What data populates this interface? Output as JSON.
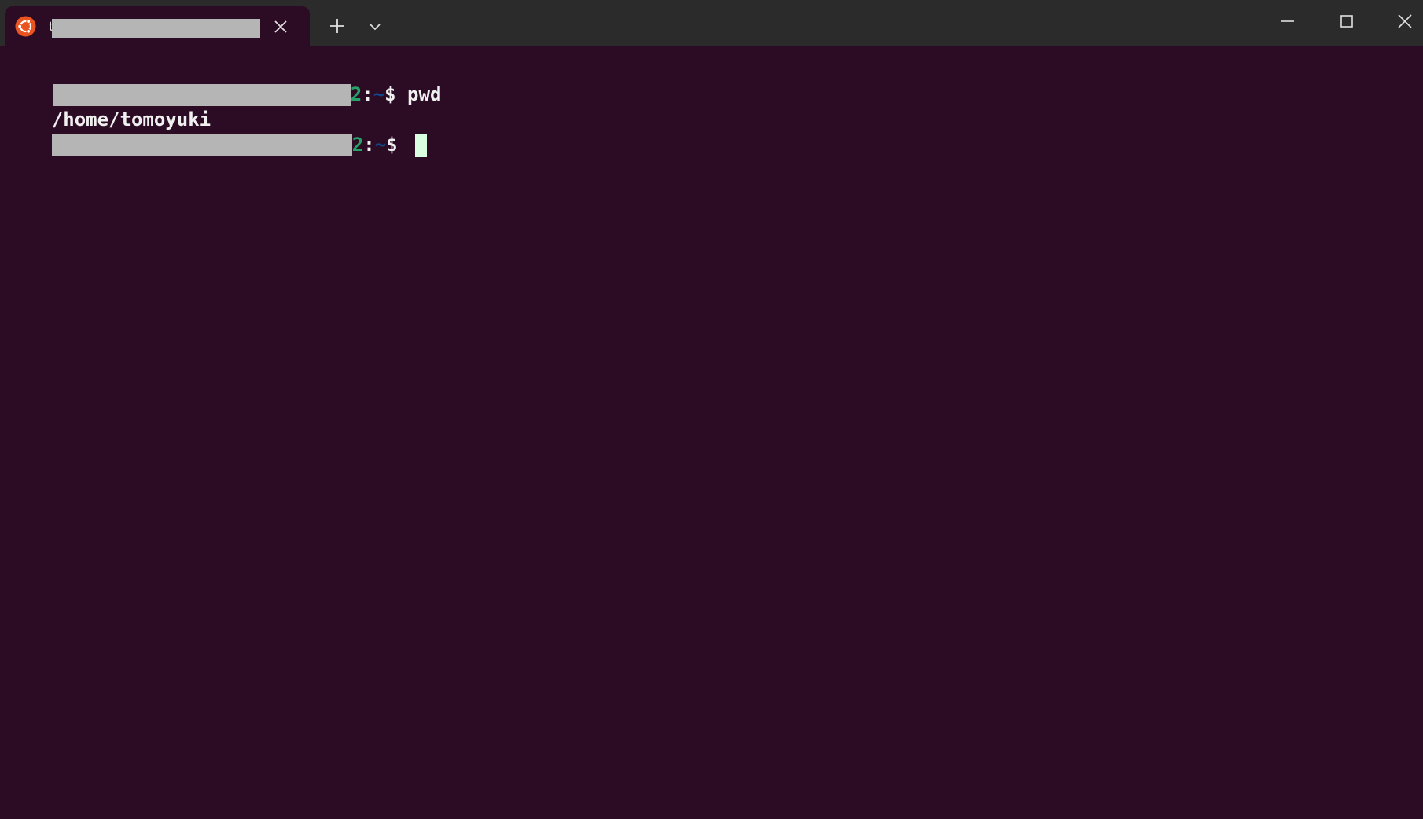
{
  "window": {
    "tab_title": "t",
    "icon": "ubuntu-icon",
    "buttons": {
      "close_tab": "close-icon",
      "new_tab": "plus-icon",
      "dropdown": "chevron-down-icon",
      "minimize": "minimize-icon",
      "maximize": "maximize-icon",
      "close": "close-icon"
    }
  },
  "terminal": {
    "lines": [
      {
        "prompt_user_end": "2",
        "colon": ":",
        "path": "~",
        "dollar": "$",
        "command": " pwd"
      },
      {
        "output": "/home/tomoyuki"
      },
      {
        "prompt_user_end": "2",
        "colon": ":",
        "path": "~",
        "dollar": "$",
        "command": " "
      }
    ]
  },
  "colors": {
    "terminal_bg": "#2c0c24",
    "titlebar_bg": "#2b2b2b",
    "prompt_user": "#26a269",
    "prompt_path": "#12488b",
    "cursor": "#d9ffe0"
  }
}
